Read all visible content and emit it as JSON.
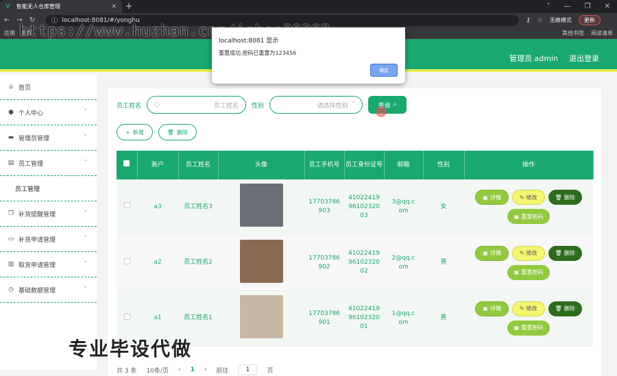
{
  "browser": {
    "tab_title": "智能无人仓库管理",
    "url": "localhost:8081/#/yonghu",
    "incognito": "无痕模式",
    "update": "更新",
    "bookmarks": [
      "应用",
      "主页"
    ],
    "bookmarks_right": [
      "其他书签",
      "阅读清单"
    ]
  },
  "watermark_url": "https://www.huzhan.com/ishop39397",
  "header": {
    "admin_label": "管理员 admin",
    "logout": "退出登录"
  },
  "sidebar": {
    "items": [
      {
        "label": "首页",
        "icon": "home-icon",
        "chev": ""
      },
      {
        "label": "个人中心",
        "icon": "user-icon",
        "chev": "˅"
      },
      {
        "label": "管理员管理",
        "icon": "briefcase-icon",
        "chev": "˅"
      },
      {
        "label": "员工管理",
        "icon": "clipboard-icon",
        "chev": "˄"
      },
      {
        "label": "员工管理",
        "icon": "",
        "chev": "",
        "sub": true
      },
      {
        "label": "补货提醒管理",
        "icon": "copy-icon",
        "chev": "˅"
      },
      {
        "label": "补货申请管理",
        "icon": "monitor-icon",
        "chev": "˅"
      },
      {
        "label": "取货申请管理",
        "icon": "chart-icon",
        "chev": "˅"
      },
      {
        "label": "基础数据管理",
        "icon": "clock-icon",
        "chev": "˅"
      }
    ]
  },
  "search": {
    "name_label": "员工姓名",
    "name_placeholder": "员工姓名",
    "gender_label": "性别",
    "gender_placeholder": "请选择性别",
    "query_button": "查询"
  },
  "actions": {
    "add": "新增",
    "delete": "删除"
  },
  "table": {
    "headers": [
      "",
      "账户",
      "员工姓名",
      "头像",
      "员工手机号",
      "员工身份证号",
      "邮箱",
      "性别",
      "操作"
    ],
    "rows": [
      {
        "account": "a3",
        "name": "员工姓名3",
        "phone": "17703786903",
        "idcard": "410224199610232003",
        "email": "3@qq.com",
        "gender": "女",
        "avatar_color": "#6b7076"
      },
      {
        "account": "a2",
        "name": "员工姓名2",
        "phone": "17703786902",
        "idcard": "410224199610232002",
        "email": "2@qq.com",
        "gender": "男",
        "avatar_color": "#8a6a52"
      },
      {
        "account": "a1",
        "name": "员工姓名1",
        "phone": "17703786901",
        "idcard": "410224199610232001",
        "email": "1@qq.com",
        "gender": "男",
        "avatar_color": "#c9b7a6"
      }
    ],
    "ops": {
      "detail": "详情",
      "edit": "修改",
      "delete": "删除",
      "reset": "重置密码"
    }
  },
  "pager": {
    "total": "共 3 条",
    "size": "10条/页",
    "current": "1",
    "goto": "前往",
    "page_input": "1",
    "page_unit": "页"
  },
  "dialog": {
    "title": "localhost:8081 显示",
    "message": "重置成功,密码已重置为123456",
    "ok": "确定"
  },
  "overlay_text": "专业毕设代做",
  "colors": {
    "primary": "#19a86e",
    "accent": "#e8f050"
  }
}
